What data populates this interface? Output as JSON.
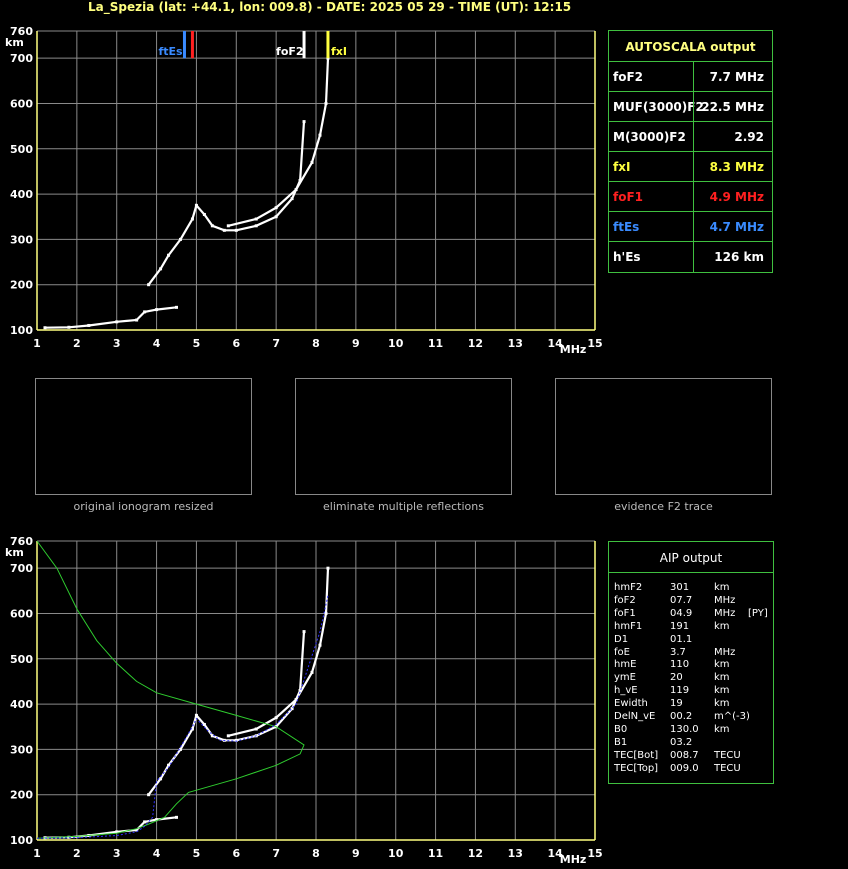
{
  "header": {
    "title": "La_Spezia (lat: +44.1, lon: 009.8) - DATE: 2025 05 29 - TIME (UT): 12:15"
  },
  "colors": {
    "grid": "#8a8a8a",
    "axis": "#ffff80",
    "table_border": "#3fbf3f",
    "foF1": "#ff2020",
    "ftEs": "#3a8bff",
    "fxI": "#ffff40",
    "model_green": "#2fcc2f",
    "trace_blue": "#3030ff"
  },
  "axes": {
    "x_ticks": [
      "1",
      "2",
      "3",
      "4",
      "5",
      "6",
      "7",
      "8",
      "9",
      "10",
      "11",
      "12",
      "13",
      "14",
      "15"
    ],
    "x_unit": "MHz",
    "y_ticks": [
      "100",
      "200",
      "300",
      "400",
      "500",
      "600",
      "700",
      "760"
    ],
    "y_unit": "km"
  },
  "markers": {
    "ftEs_label": "ftEs",
    "foF1_label": "foF1",
    "foF2_label": "foF2",
    "fxI_label": "fxI"
  },
  "autoscala": {
    "title": "AUTOSCALA output",
    "rows": [
      {
        "k": "foF2",
        "v": "7.7 MHz",
        "color": "#ffffff"
      },
      {
        "k": "MUF(3000)F2",
        "v": "22.5 MHz",
        "color": "#ffffff"
      },
      {
        "k": "M(3000)F2",
        "v": "2.92",
        "color": "#ffffff"
      },
      {
        "k": "fxI",
        "v": "8.3 MHz",
        "color": "#ffff40"
      },
      {
        "k": "foF1",
        "v": "4.9 MHz",
        "color": "#ff2020"
      },
      {
        "k": "ftEs",
        "v": "4.7 MHz",
        "color": "#3a8bff"
      },
      {
        "k": "h'Es",
        "v": "126    km",
        "color": "#ffffff"
      }
    ]
  },
  "thumbnails": [
    {
      "caption": "original ionogram resized"
    },
    {
      "caption": "eliminate multiple reflections"
    },
    {
      "caption": "evidence F2 trace"
    }
  ],
  "aip": {
    "title": "AIP output",
    "rows": [
      {
        "k": "hmF2",
        "v": "301",
        "u": "km"
      },
      {
        "k": "foF2",
        "v": "07.7",
        "u": "MHz"
      },
      {
        "k": "foF1",
        "v": "04.9",
        "u": "MHz",
        "x": "[PY]"
      },
      {
        "k": "hmF1",
        "v": "191",
        "u": "km"
      },
      {
        "k": "D1",
        "v": "01.1",
        "u": ""
      },
      {
        "k": "foE",
        "v": "3.7",
        "u": "MHz"
      },
      {
        "k": "hmE",
        "v": "110",
        "u": "km"
      },
      {
        "k": "ymE",
        "v": "20",
        "u": "km"
      },
      {
        "k": "h_vE",
        "v": "119",
        "u": "km"
      },
      {
        "k": "Ewidth",
        "v": "19",
        "u": "km"
      },
      {
        "k": "DelN_vE",
        "v": "00.2",
        "u": "m^(-3)"
      },
      {
        "k": "B0",
        "v": "130.0",
        "u": "km"
      },
      {
        "k": "B1",
        "v": "03.2",
        "u": ""
      },
      {
        "k": "TEC[Bot]",
        "v": "008.7",
        "u": "TECU"
      },
      {
        "k": "TEC[Top]",
        "v": "009.0",
        "u": "TECU"
      }
    ]
  },
  "chart_data": [
    {
      "type": "scatter",
      "xlabel": "MHz",
      "ylabel": "km",
      "xlim": [
        1,
        15
      ],
      "ylim": [
        100,
        760
      ],
      "grid": true,
      "series": [
        {
          "values": [
            [
              1.2,
              105
            ],
            [
              1.8,
              106
            ],
            [
              2.3,
              110
            ],
            [
              3.0,
              118
            ],
            [
              3.5,
              122
            ],
            [
              3.7,
              140
            ],
            [
              4.0,
              145
            ],
            [
              4.5,
              150
            ]
          ]
        },
        {
          "values": [
            [
              3.8,
              200
            ],
            [
              4.1,
              235
            ],
            [
              4.3,
              265
            ],
            [
              4.6,
              300
            ],
            [
              4.9,
              345
            ],
            [
              5.0,
              375
            ],
            [
              5.2,
              355
            ],
            [
              5.4,
              330
            ],
            [
              5.7,
              320
            ],
            [
              6.0,
              320
            ],
            [
              6.5,
              330
            ],
            [
              7.0,
              350
            ],
            [
              7.4,
              390
            ],
            [
              7.6,
              430
            ],
            [
              7.7,
              560
            ]
          ]
        },
        {
          "values": [
            [
              5.8,
              330
            ],
            [
              6.5,
              345
            ],
            [
              7.0,
              370
            ],
            [
              7.5,
              410
            ],
            [
              7.9,
              470
            ],
            [
              8.1,
              530
            ],
            [
              8.25,
              600
            ],
            [
              8.3,
              700
            ]
          ]
        }
      ],
      "markers": [
        {
          "name": "ftEs",
          "x": 4.7
        },
        {
          "name": "foF1",
          "x": 4.9
        },
        {
          "name": "foF2",
          "x": 7.7
        },
        {
          "name": "fxI",
          "x": 8.3
        }
      ]
    },
    {
      "type": "scatter",
      "xlabel": "MHz",
      "ylabel": "km",
      "xlim": [
        1,
        15
      ],
      "ylim": [
        100,
        760
      ],
      "grid": true,
      "series": [
        {
          "values": [
            [
              1.2,
              105
            ],
            [
              1.8,
              106
            ],
            [
              2.3,
              110
            ],
            [
              3.0,
              118
            ],
            [
              3.5,
              122
            ],
            [
              3.7,
              140
            ],
            [
              4.0,
              145
            ],
            [
              4.5,
              150
            ]
          ]
        },
        {
          "values": [
            [
              3.8,
              200
            ],
            [
              4.1,
              235
            ],
            [
              4.3,
              265
            ],
            [
              4.6,
              300
            ],
            [
              4.9,
              345
            ],
            [
              5.0,
              375
            ],
            [
              5.2,
              355
            ],
            [
              5.4,
              330
            ],
            [
              5.7,
              320
            ],
            [
              6.0,
              320
            ],
            [
              6.5,
              330
            ],
            [
              7.0,
              350
            ],
            [
              7.4,
              390
            ],
            [
              7.6,
              430
            ],
            [
              7.7,
              560
            ]
          ]
        },
        {
          "values": [
            [
              5.8,
              330
            ],
            [
              6.5,
              345
            ],
            [
              7.0,
              370
            ],
            [
              7.5,
              410
            ],
            [
              7.9,
              470
            ],
            [
              8.1,
              530
            ],
            [
              8.25,
              600
            ],
            [
              8.3,
              700
            ]
          ]
        },
        {
          "values": [
            [
              1.0,
              760
            ],
            [
              1.5,
              700
            ],
            [
              2.0,
              610
            ],
            [
              2.5,
              540
            ],
            [
              3.0,
              490
            ],
            [
              3.5,
              450
            ],
            [
              4.0,
              425
            ],
            [
              5.0,
              400
            ],
            [
              6.0,
              375
            ],
            [
              7.0,
              350
            ],
            [
              7.7,
              310
            ],
            [
              7.6,
              290
            ],
            [
              7.0,
              265
            ],
            [
              6.0,
              235
            ],
            [
              5.0,
              210
            ],
            [
              4.8,
              205
            ],
            [
              4.5,
              180
            ],
            [
              4.2,
              150
            ],
            [
              3.8,
              135
            ],
            [
              3.5,
              125
            ],
            [
              3.0,
              115
            ],
            [
              2.0,
              108
            ],
            [
              1.0,
              104
            ]
          ]
        },
        {
          "values": [
            [
              1.0,
              104
            ],
            [
              2.0,
              105
            ],
            [
              3.0,
              110
            ],
            [
              3.5,
              118
            ],
            [
              3.7,
              130
            ],
            [
              3.9,
              150
            ],
            [
              4.0,
              230
            ],
            [
              4.3,
              260
            ],
            [
              4.5,
              290
            ],
            [
              4.9,
              350
            ],
            [
              5.0,
              368
            ],
            [
              5.3,
              340
            ],
            [
              5.6,
              320
            ],
            [
              6.0,
              318
            ],
            [
              6.5,
              330
            ],
            [
              7.0,
              355
            ],
            [
              7.5,
              400
            ],
            [
              7.8,
              480
            ],
            [
              8.1,
              560
            ],
            [
              8.3,
              640
            ]
          ]
        }
      ]
    }
  ]
}
